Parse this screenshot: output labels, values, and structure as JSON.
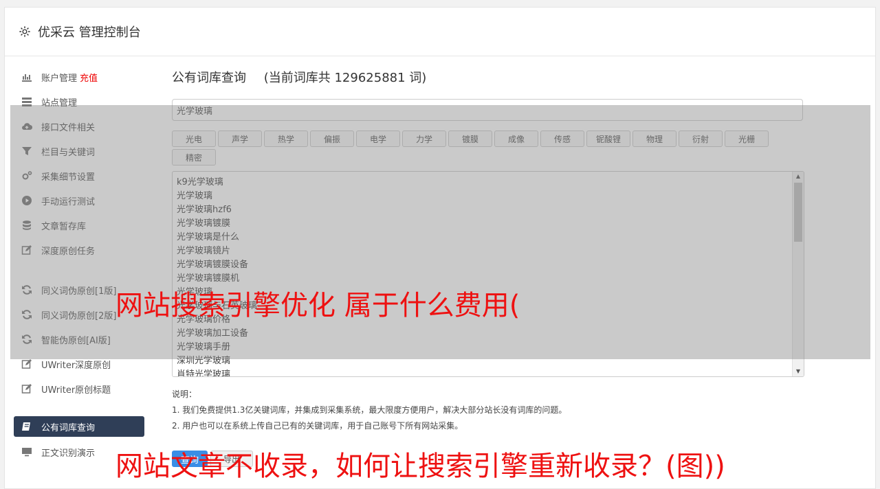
{
  "header": {
    "title": "优采云 管理控制台"
  },
  "sidebar": {
    "group1": [
      {
        "label": "账户管理",
        "tag": "充值",
        "icon": "bar-chart-icon"
      },
      {
        "label": "站点管理",
        "icon": "server-icon"
      },
      {
        "label": "接口文件相关",
        "icon": "cloud-upload-icon"
      },
      {
        "label": "栏目与关键词",
        "icon": "filter-icon"
      },
      {
        "label": "采集细节设置",
        "icon": "gears-icon"
      },
      {
        "label": "手动运行测试",
        "icon": "play-circle-icon"
      },
      {
        "label": "文章暂存库",
        "icon": "database-icon"
      },
      {
        "label": "深度原创任务",
        "icon": "edit-icon"
      }
    ],
    "group2": [
      {
        "label": "同义词伪原创[1版]",
        "icon": "refresh-icon"
      },
      {
        "label": "同义词伪原创[2版]",
        "icon": "refresh-icon"
      },
      {
        "label": "智能伪原创[AI版]",
        "icon": "refresh-icon"
      },
      {
        "label": "UWriter深度原创",
        "icon": "edit-icon"
      },
      {
        "label": "UWriter原创标题",
        "icon": "edit-icon"
      }
    ],
    "group3": [
      {
        "label": "公有词库查询",
        "icon": "book-icon",
        "active": true
      },
      {
        "label": "正文识别演示",
        "icon": "monitor-icon"
      }
    ]
  },
  "main": {
    "title": "公有词库查询",
    "count_text": "(当前词库共 129625881 词)",
    "search_value": "光学玻璃",
    "tags": [
      "光电",
      "声学",
      "热学",
      "偏振",
      "电学",
      "力学",
      "镀膜",
      "成像",
      "传感",
      "铌酸锂",
      "物理",
      "衍射",
      "光栅",
      "精密"
    ],
    "results": [
      "k9光学玻璃",
      "光学玻璃",
      "光学玻璃hzf6",
      "光学玻璃镀膜",
      "光学玻璃是什么",
      "光学玻璃镜片",
      "光学玻璃镀膜设备",
      "光学玻璃镀膜机",
      "光学玻璃",
      "光学玻璃与石英玻璃",
      "光学玻璃价格",
      "光学玻璃加工设备",
      "光学玻璃手册",
      "深圳光学玻璃",
      "肖特光学玻璃"
    ],
    "notes_title": "说明：",
    "notes": [
      "1. 我们免费提供1.3亿关键词库，并集成到采集系统，最大限度方便用户，解决大部分站长没有词库的问题。",
      "2. 用户也可以在系统上传自己已有的关键词库，用于自己账号下所有网站采集。"
    ],
    "btn_primary": "查询",
    "btn_secondary": "导出"
  },
  "overlay_text": {
    "line1": "网站搜索引擎优化 属于什么费用(",
    "line2": "网站文章不收录，如何让搜索引擎重新收录？(图))"
  }
}
